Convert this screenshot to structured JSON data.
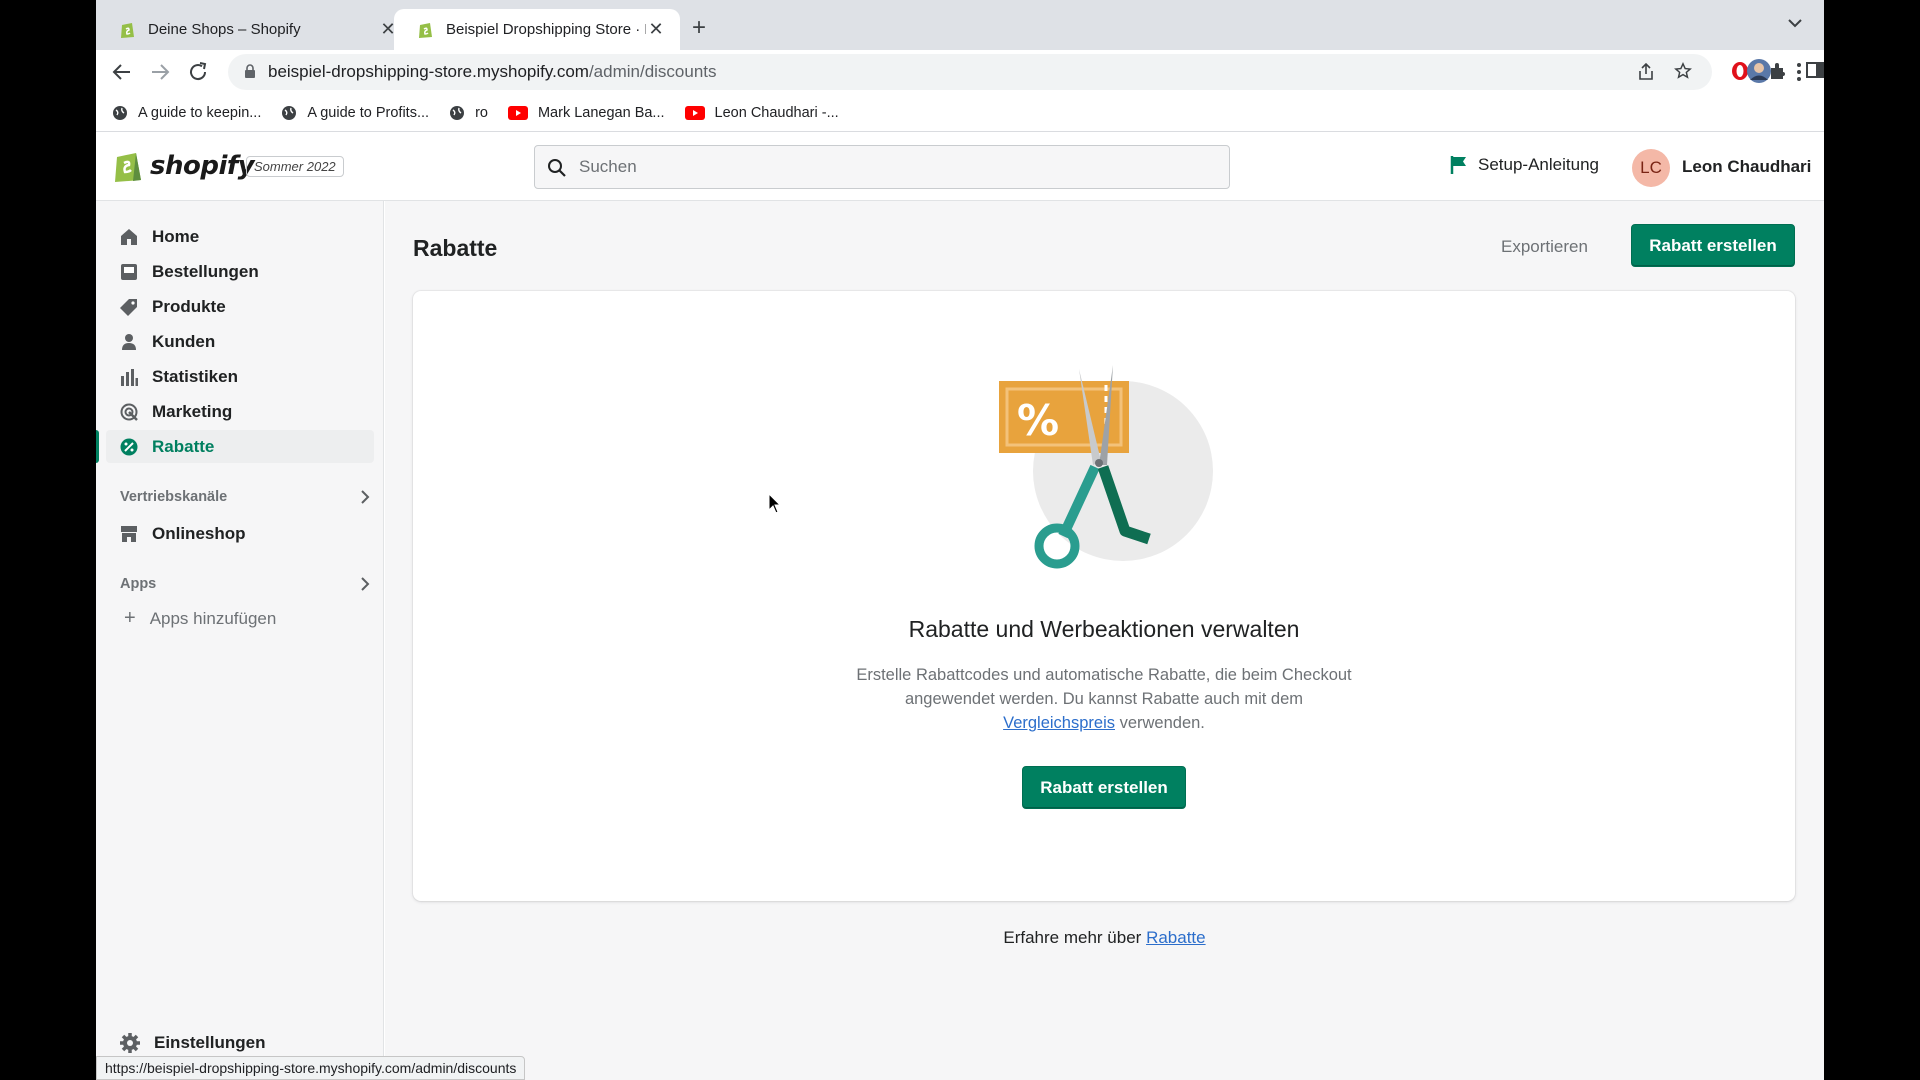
{
  "browser": {
    "tabs": [
      {
        "title": "Deine Shops – Shopify",
        "active": false
      },
      {
        "title": "Beispiel Dropshipping Store · R",
        "active": true
      }
    ],
    "url_host": "beispiel-dropshipping-store.myshopify.com",
    "url_path": "/admin/discounts",
    "bookmarks": [
      {
        "label": "A guide to keepin...",
        "icon": "globe-icon"
      },
      {
        "label": "A guide to Profits...",
        "icon": "globe-icon"
      },
      {
        "label": "ro",
        "icon": "globe-icon"
      },
      {
        "label": "Mark Lanegan Ba...",
        "icon": "youtube-icon"
      },
      {
        "label": "Leon Chaudhari -...",
        "icon": "youtube-icon"
      }
    ],
    "status_url": "https://beispiel-dropshipping-store.myshopify.com/admin/discounts"
  },
  "topbar": {
    "logo": "shopify",
    "edition": "Sommer 2022",
    "search_placeholder": "Suchen",
    "setup_label": "Setup-Anleitung",
    "avatar_initials": "LC",
    "user_name": "Leon Chaudhari"
  },
  "sidebar": {
    "items": [
      {
        "label": "Home",
        "icon": "home-icon"
      },
      {
        "label": "Bestellungen",
        "icon": "orders-icon"
      },
      {
        "label": "Produkte",
        "icon": "tag-icon"
      },
      {
        "label": "Kunden",
        "icon": "person-icon"
      },
      {
        "label": "Statistiken",
        "icon": "bar-chart-icon"
      },
      {
        "label": "Marketing",
        "icon": "marketing-icon"
      },
      {
        "label": "Rabatte",
        "icon": "discount-icon",
        "active": true
      }
    ],
    "sales_channels_heading": "Vertriebskanäle",
    "online_store": "Onlineshop",
    "apps_heading": "Apps",
    "add_apps": "Apps hinzufügen",
    "settings": "Einstellungen"
  },
  "main": {
    "title": "Rabatte",
    "export_label": "Exportieren",
    "create_label": "Rabatt erstellen",
    "empty_heading": "Rabatte und Werbeaktionen verwalten",
    "empty_desc_before": "Erstelle Rabattcodes und automatische Rabatte, die beim Checkout angewendet werden. Du kannst Rabatte auch mit dem ",
    "empty_desc_link": "Vergleichspreis",
    "empty_desc_after": " verwenden.",
    "empty_button": "Rabatt erstellen",
    "learn_more_prefix": "Erfahre mehr über ",
    "learn_more_link": "Rabatte"
  },
  "colors": {
    "primary": "#008060",
    "link": "#2c6ecb",
    "coupon": "#e8a33d"
  }
}
